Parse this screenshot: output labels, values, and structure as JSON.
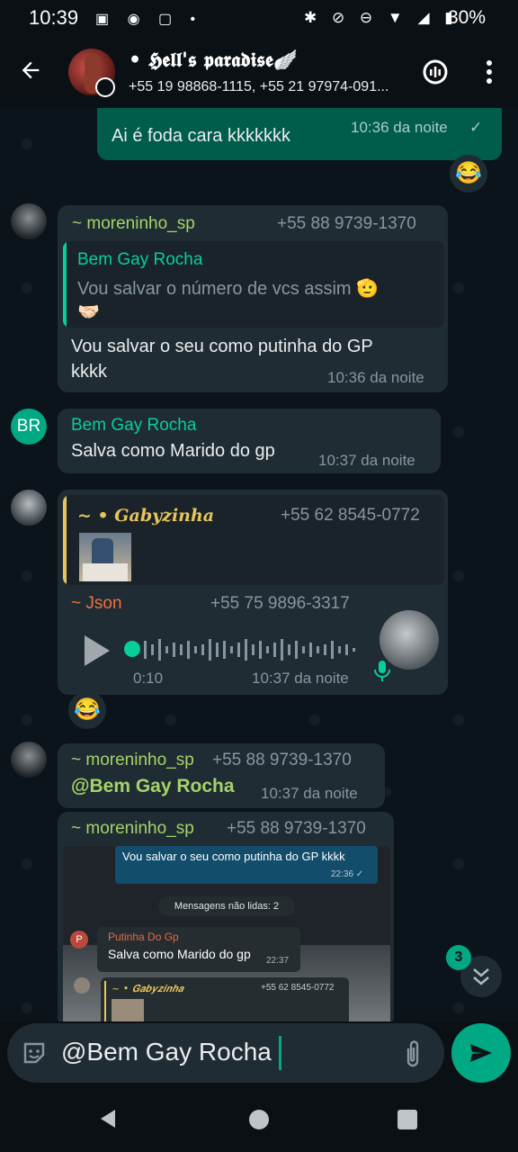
{
  "status_bar": {
    "time": "10:39",
    "battery": "30%"
  },
  "header": {
    "title": "• 𝕳𝖊𝖑𝖑'𝖘 𝖕𝖆𝖗𝖆𝖉𝖎𝖘𝖊🪽",
    "subtitle": "+55 19 98868-1115, +55 21 97974-091..."
  },
  "messages": {
    "m1": {
      "text": "Ai é foda cara kkkkkkk",
      "time": "10:36 da noite",
      "check": "✓",
      "reaction": "😂"
    },
    "m2": {
      "sender": "~ moreninho_sp",
      "phone": "+55 88 9739-1370",
      "quote_sender": "Bem Gay Rocha",
      "quote_text": "Vou salvar o número de vcs assim 🫡",
      "quote_text2": "🤝🏻",
      "text_line1": "Vou salvar o seu como putinha do GP",
      "text_line2": "kkkk",
      "time": "10:36 da noite"
    },
    "m3": {
      "initials": "BR",
      "sender": "Bem Gay Rocha",
      "text": "Salva como Marido do gp",
      "time": "10:37 da noite"
    },
    "m4": {
      "quote_sender": "~ • 𝑮𝒂𝒃𝒚𝒛𝒊𝒏𝒉𝒂",
      "quote_phone": "+55 62 8545-0772",
      "sender": "~ Json",
      "phone": "+55 75 9896-3317",
      "duration": "0:10",
      "time": "10:37 da noite",
      "reaction": "😂"
    },
    "m5": {
      "sender": "~ moreninho_sp",
      "phone": "+55 88 9739-1370",
      "mention": "@Bem Gay Rocha",
      "time": "10:37 da noite"
    },
    "m6": {
      "sender": "~ moreninho_sp",
      "phone": "+55 88 9739-1370",
      "shot": {
        "out_text": "Vou salvar o seu como putinha do GP kkkk",
        "out_time": "22:36 ✓",
        "unread": "Mensagens não lidas: 2",
        "p_initial": "P",
        "p_name": "Putinha Do Gp",
        "p_text": "Salva como Marido do gp",
        "p_time": "22:37",
        "g_name": "~ • 𝑮𝒂𝒃𝒚𝒛𝒊𝒏𝒉𝒂",
        "g_phone": "+55 62 8545-0772"
      }
    }
  },
  "scroll_badge": "3",
  "composer": {
    "value": "@Bem Gay Rocha"
  },
  "colors": {
    "accent": "#00a884",
    "orange": "#f07042",
    "gold": "#e6c65a",
    "name_green": "#a5d36a"
  }
}
